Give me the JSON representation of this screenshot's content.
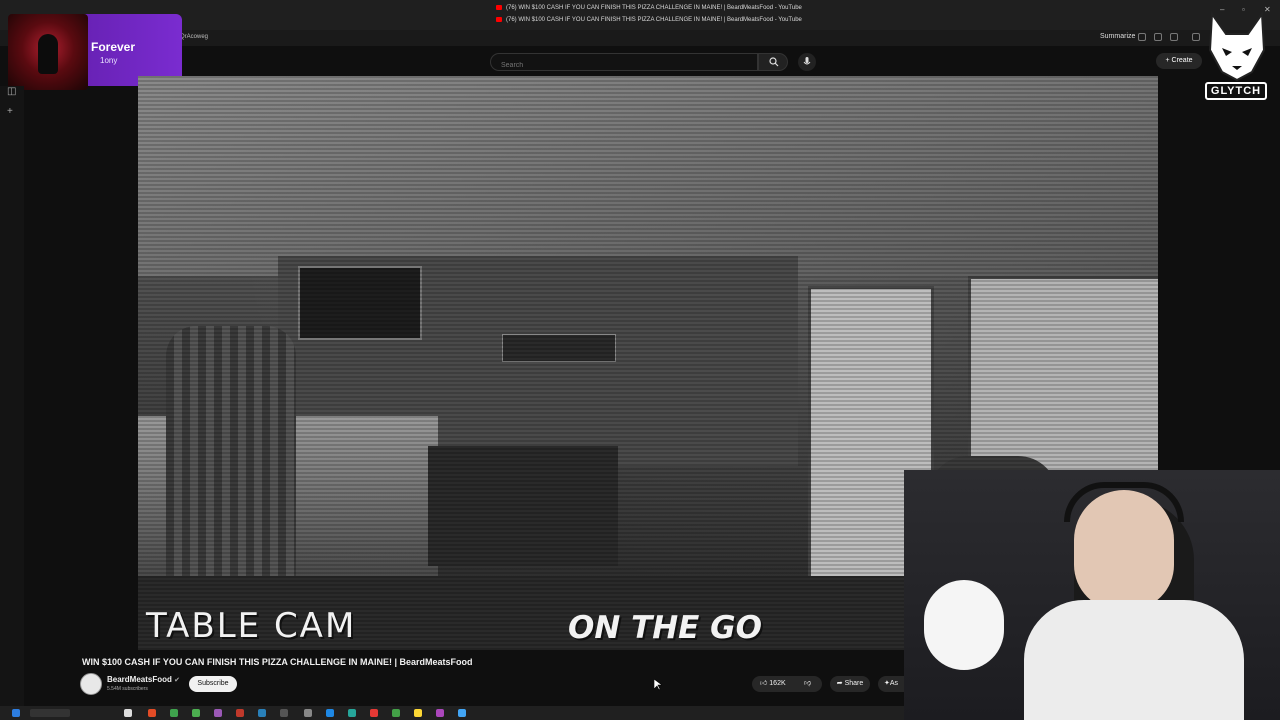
{
  "browser": {
    "tab_titles": [
      "(76) WIN $100 CASH IF YOU CAN FINISH THIS PIZZA CHALLENGE IN MAINE! | BeardMeatsFood - YouTube",
      "(76) WIN $100 CASH IF YOU CAN FINISH THIS PIZZA CHALLENGE IN MAINE! | BeardMeatsFood - YouTube"
    ],
    "url_fragment": "QrAcoweg",
    "summarize_label": "Summarize"
  },
  "music_overlay": {
    "song_title": "Forever",
    "artist": "1ony"
  },
  "youtube": {
    "search_placeholder": "Search",
    "create_label": "Create"
  },
  "stream_logo": {
    "text": "GLYTCH"
  },
  "video": {
    "overlay_left": "TABLE CAM",
    "overlay_center": "ON THE GO",
    "title": "WIN $100 CASH IF YOU CAN FINISH THIS PIZZA CHALLENGE IN MAINE! | BeardMeatsFood",
    "channel_name": "BeardMeatsFood",
    "verified_icon": "check-circle-icon",
    "subscribers": "5.54M subscribers",
    "subscribe_label": "Subscribe",
    "like_count": "162K",
    "share_label": "Share",
    "ask_label": "As"
  },
  "colors": {
    "background": "#0f0f0f",
    "accent_red": "#ff0000",
    "music_purple": "#6a22b8"
  }
}
